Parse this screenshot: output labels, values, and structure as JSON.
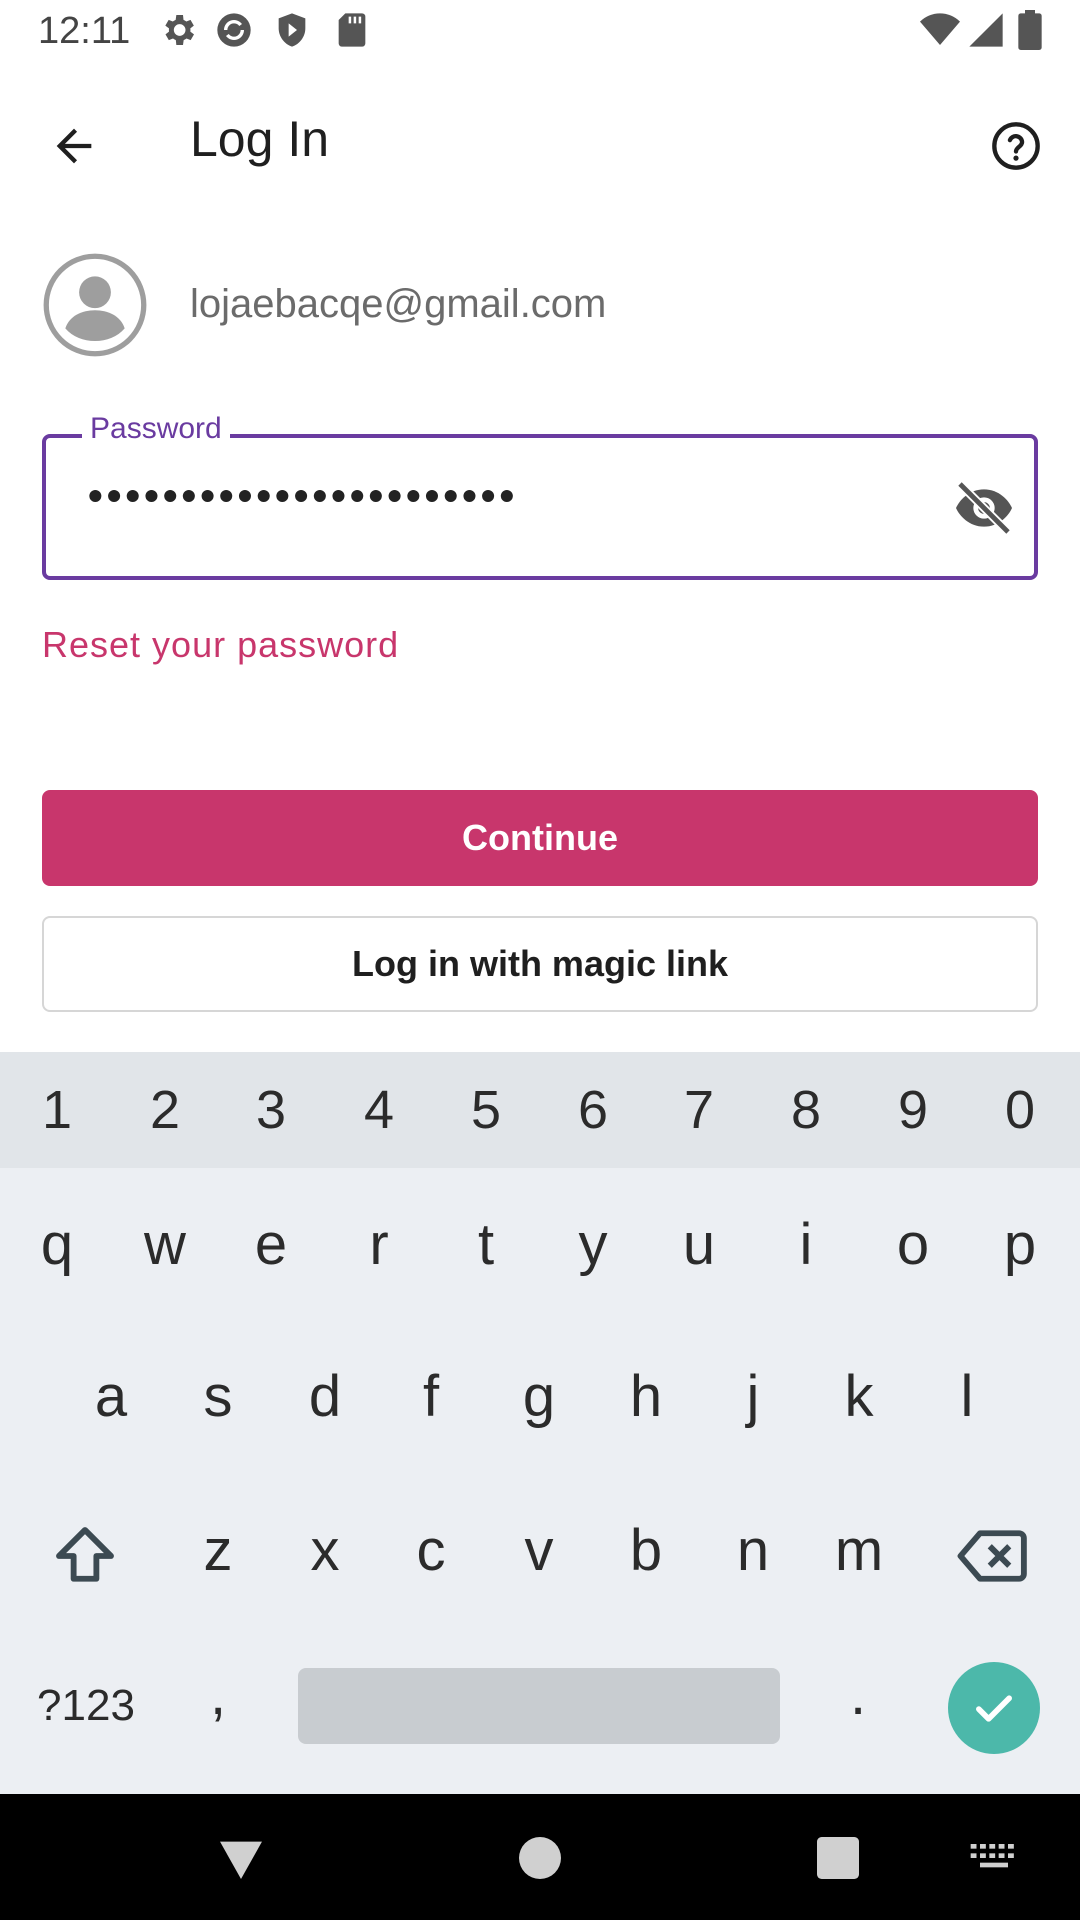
{
  "status_bar": {
    "time": "12:11",
    "icons": [
      "settings-icon",
      "sync-icon",
      "shield-icon",
      "sd-card-icon",
      "wifi-icon",
      "signal-icon",
      "battery-icon"
    ]
  },
  "app_bar": {
    "title": "Log In",
    "back_icon": "arrow-back-icon",
    "help_icon": "help-circle-icon"
  },
  "account": {
    "email": "lojaebacqe@gmail.com"
  },
  "password": {
    "label": "Password",
    "masked_value": "•••••••••••••••••••••••",
    "toggle_icon": "visibility-off-icon"
  },
  "reset_link": "Reset your password",
  "buttons": {
    "continue": "Continue",
    "magic_link": "Log in with magic link"
  },
  "keyboard": {
    "numbers": [
      "1",
      "2",
      "3",
      "4",
      "5",
      "6",
      "7",
      "8",
      "9",
      "0"
    ],
    "row1": [
      "q",
      "w",
      "e",
      "r",
      "t",
      "y",
      "u",
      "i",
      "o",
      "p"
    ],
    "row2": [
      "a",
      "s",
      "d",
      "f",
      "g",
      "h",
      "j",
      "k",
      "l"
    ],
    "row3": [
      "z",
      "x",
      "c",
      "v",
      "b",
      "n",
      "m"
    ],
    "symbols_key": "?123",
    "comma": ",",
    "period": "."
  },
  "colors": {
    "accent": "#c8366c",
    "field_border": "#6a3ba0",
    "done_key": "#4cb8aa"
  }
}
